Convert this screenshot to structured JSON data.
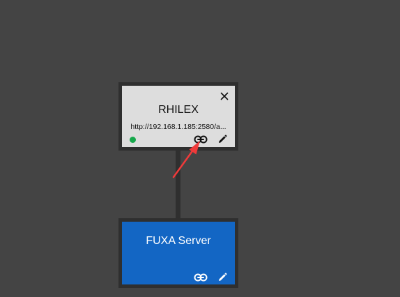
{
  "canvas": {
    "background": "#444444"
  },
  "nodes": [
    {
      "title": "RHILEX",
      "url": "http://192.168.1.185:2580/a...",
      "status": "connected",
      "status_color": "#16a84b",
      "background": "#dddddd",
      "icons": [
        "close-icon",
        "link-icon",
        "edit-icon"
      ]
    },
    {
      "title": "FUXA Server",
      "background": "#1366c4",
      "icons": [
        "link-icon",
        "edit-icon"
      ]
    }
  ],
  "annotation": {
    "type": "arrow",
    "color": "#f03a3a",
    "target": "link-icon"
  }
}
